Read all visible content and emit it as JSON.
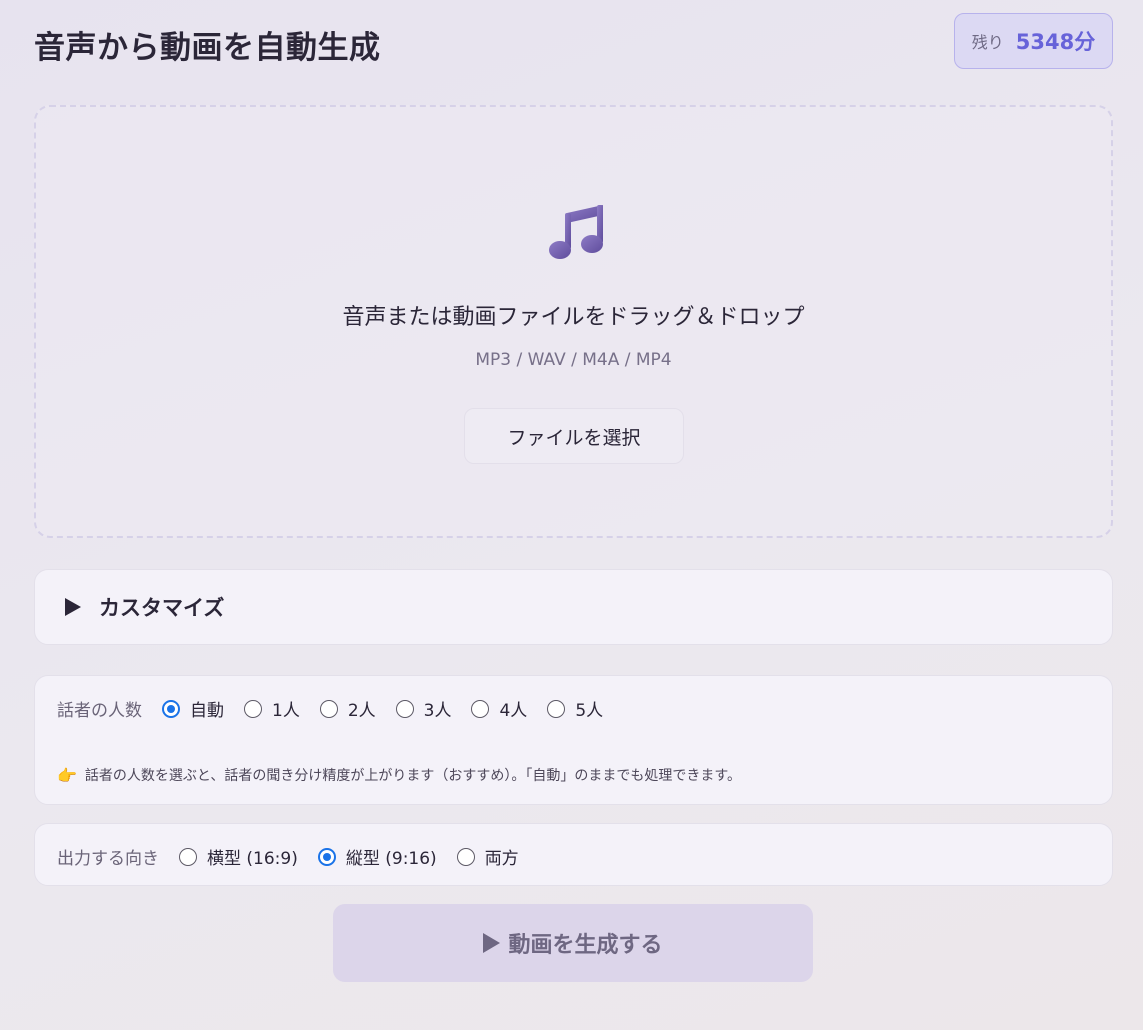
{
  "header": {
    "title": "音声から動画を自動生成",
    "credit_label": "残り",
    "credit_value": "5348分"
  },
  "dropzone": {
    "icon": "music-note-icon",
    "title": "音声または動画ファイルをドラッグ＆ドロップ",
    "formats": "MP3 / WAV / M4A / MP4",
    "button_label": "ファイルを選択"
  },
  "customize": {
    "label": "カスタマイズ"
  },
  "speakers": {
    "label": "話者の人数",
    "options": [
      "自動",
      "1人",
      "2人",
      "3人",
      "4人",
      "5人"
    ],
    "selected": "自動",
    "hint_icon": "👉",
    "hint": "話者の人数を選ぶと、話者の聞き分け精度が上がります（おすすめ）。「自動」のままでも処理できます。"
  },
  "orientation": {
    "label": "出力する向き",
    "options": [
      "横型 (16:9)",
      "縦型 (9:16)",
      "両方"
    ],
    "selected": "縦型 (9:16)"
  },
  "generate": {
    "label": "動画を生成する"
  },
  "colors": {
    "accent": "#6763d9",
    "radio_checked": "#1a73e8",
    "icon_purple": "#6f5ba8"
  }
}
